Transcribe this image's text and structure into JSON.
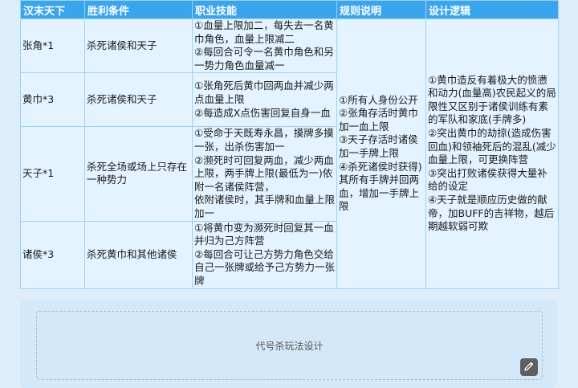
{
  "table": {
    "headers": [
      "汉末天下",
      "胜利条件",
      "职业技能",
      "规则说明",
      "设计逻辑"
    ],
    "rows": [
      {
        "role": "张角*1",
        "win": "杀死诸侯和天子",
        "skill": "①血量上限加二，每失去一名黄巾角色，血量上限减二\n②每回合可令一名黄巾角色和另一势力角色血量减一"
      },
      {
        "role": "黄巾*3",
        "win": "杀死诸侯和天子",
        "skill": "①张角死后黄巾回两血并减少两点血量上限\n②每造成X点伤害回复自身一血"
      },
      {
        "role": "天子*1",
        "win": "杀死全场或场上只存在一种势力",
        "skill": "①受命于天既寿永昌，摸牌多摸一张，出杀伤害加一\n②濒死时可回复两血，减少两血上限，两手牌上限(最低为一)依附一名诸侯阵营，\n依附诸侯时，其手牌和血量上限加一"
      },
      {
        "role": "诸侯*3",
        "win": "杀死黄巾和其他诸侯",
        "skill": "①将黄巾变为濒死时回复其一血并归为己方阵营\n②每回合可让己方势力角色交给自己一张牌或给予己方势力一张牌"
      }
    ],
    "rules": "①所有人身份公开\n②张角存活时黄巾加一血上限\n③天子存活时诸侯加一手牌上限\n④杀死诸侯时获得)其所有手牌并回两血，增加一手牌上限",
    "design": "①黄巾造反有着极大的愤懑和动力(血量高)农民起义的局限性又区别于诸侯训练有素的军队和家底(手牌多)\n②突出黄巾的劫掠(造成伤害回血)和领袖死后的混乱(减少血量上限，可更换阵营\n③突出打败诸侯获得大量补给的设定\n④天子就是顺应历史做的献帝，加BUFF的吉祥物，越后期越软弱可欺"
  },
  "card": {
    "title": "代号杀玩法设计"
  },
  "icons": {
    "edit": "pencil-icon"
  }
}
